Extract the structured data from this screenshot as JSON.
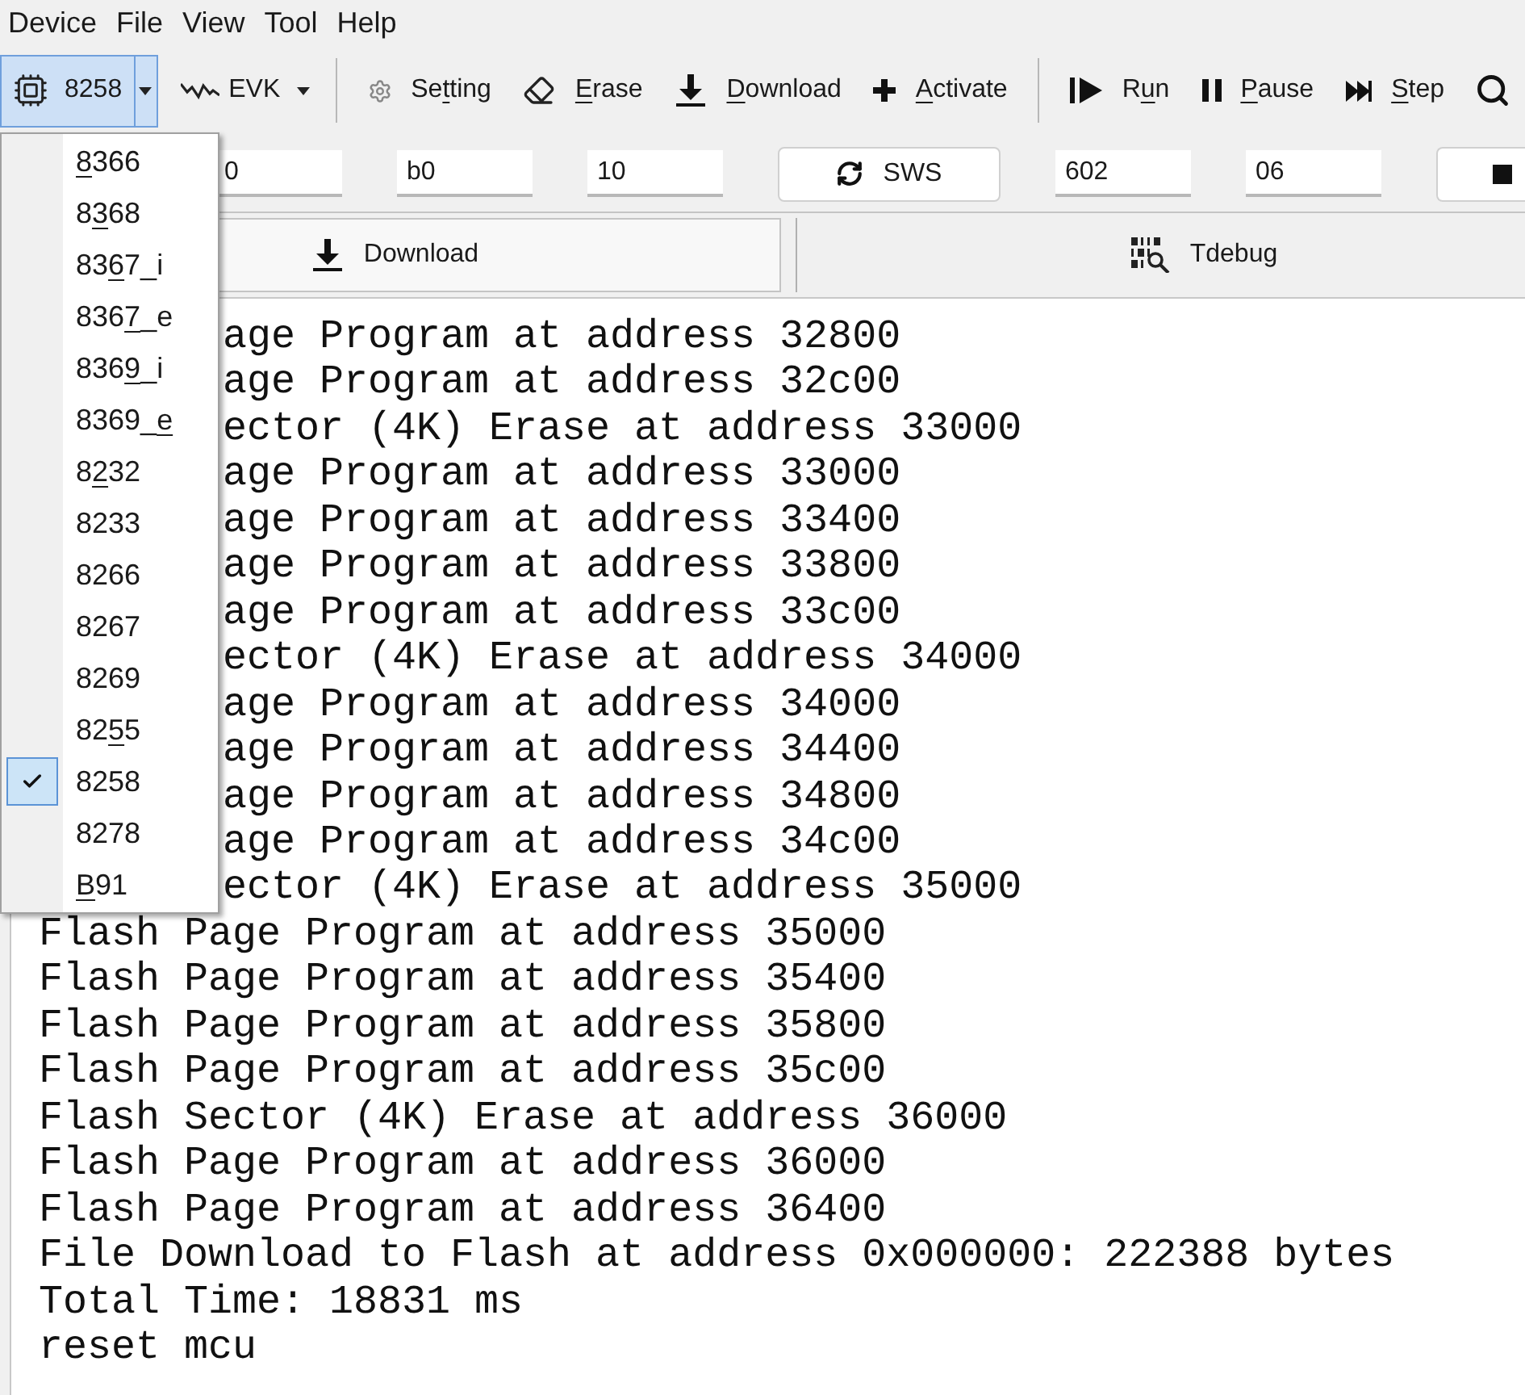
{
  "menu_bar": [
    "Device",
    "File",
    "View",
    "Tool",
    "Help"
  ],
  "toolbar": {
    "groups": [
      [
        {
          "kind": "split",
          "label": "8258",
          "expanded": true
        },
        {
          "kind": "dropdown",
          "label": "EVK"
        }
      ],
      [
        {
          "kind": "action",
          "label": [
            {
              "text": "Se",
              "underlined": false
            },
            {
              "text": "t",
              "underlined": true
            },
            {
              "text": "ting",
              "underlined": false
            }
          ]
        },
        {
          "kind": "action",
          "label": [
            {
              "text": "E",
              "underlined": true
            },
            {
              "text": "rase",
              "underlined": false
            }
          ]
        },
        {
          "kind": "action",
          "label": [
            {
              "text": "D",
              "underlined": true
            },
            {
              "text": "ownload",
              "underlined": false
            }
          ]
        },
        {
          "kind": "action",
          "label": [
            {
              "text": "A",
              "underlined": true
            },
            {
              "text": "ctivate",
              "underlined": false
            }
          ]
        }
      ],
      [
        {
          "kind": "action",
          "label": [
            {
              "text": "R",
              "underlined": false
            },
            {
              "text": "u",
              "underlined": true
            },
            {
              "text": "n",
              "underlined": false
            }
          ]
        },
        {
          "kind": "action",
          "label": [
            {
              "text": "P",
              "underlined": true
            },
            {
              "text": "ause",
              "underlined": false
            }
          ]
        },
        {
          "kind": "action",
          "label": [
            {
              "text": "S",
              "underlined": true
            },
            {
              "text": "tep",
              "underlined": false
            }
          ]
        },
        {
          "kind": "icon"
        }
      ]
    ]
  },
  "chip_menu": {
    "items": [
      {
        "label": [
          {
            "text": "8",
            "underlined": true
          },
          {
            "text": "366",
            "underlined": false
          }
        ],
        "selected": false
      },
      {
        "label": [
          {
            "text": "8",
            "underlined": false
          },
          {
            "text": "3",
            "underlined": true
          },
          {
            "text": "68",
            "underlined": false
          }
        ],
        "selected": false
      },
      {
        "label": [
          {
            "text": "83",
            "underlined": false
          },
          {
            "text": "6",
            "underlined": true
          },
          {
            "text": "7_i",
            "underlined": false
          }
        ],
        "selected": false
      },
      {
        "label": [
          {
            "text": "836",
            "underlined": false
          },
          {
            "text": "7",
            "underlined": true
          },
          {
            "text": "_e",
            "underlined": false
          }
        ],
        "selected": false
      },
      {
        "label": [
          {
            "text": "836",
            "underlined": false
          },
          {
            "text": "9",
            "underlined": true
          },
          {
            "text": "_i",
            "underlined": false
          }
        ],
        "selected": false
      },
      {
        "label": [
          {
            "text": "8369_",
            "underlined": false
          },
          {
            "text": "e",
            "underlined": true
          }
        ],
        "selected": false
      },
      {
        "label": [
          {
            "text": "8",
            "underlined": false
          },
          {
            "text": "2",
            "underlined": true
          },
          {
            "text": "32",
            "underlined": false
          }
        ],
        "selected": false
      },
      {
        "label": [
          {
            "text": "8233",
            "underlined": false
          }
        ],
        "selected": false
      },
      {
        "label": [
          {
            "text": "8266",
            "underlined": false
          }
        ],
        "selected": false
      },
      {
        "label": [
          {
            "text": "8267",
            "underlined": false
          }
        ],
        "selected": false
      },
      {
        "label": [
          {
            "text": "8269",
            "underlined": false
          }
        ],
        "selected": false
      },
      {
        "label": [
          {
            "text": "82",
            "underlined": false
          },
          {
            "text": "5",
            "underlined": true
          },
          {
            "text": "5",
            "underlined": false
          }
        ],
        "selected": false
      },
      {
        "label": [
          {
            "text": "8258",
            "underlined": false
          }
        ],
        "selected": true
      },
      {
        "label": [
          {
            "text": "8278",
            "underlined": false
          }
        ],
        "selected": false
      },
      {
        "label": [
          {
            "text": "B",
            "underlined": true
          },
          {
            "text": "91",
            "underlined": false
          }
        ],
        "selected": false
      }
    ]
  },
  "controls": [
    {
      "kind": "input",
      "value": "0"
    },
    {
      "kind": "input",
      "value": "b0"
    },
    {
      "kind": "input",
      "value": "10"
    },
    {
      "kind": "button",
      "label": "SWS"
    },
    {
      "kind": "input",
      "value": "602"
    },
    {
      "kind": "input",
      "value": "06"
    },
    {
      "kind": "button"
    }
  ],
  "tabs": [
    {
      "label": "Download",
      "selected": true
    },
    {
      "label": "Tdebug",
      "selected": false
    }
  ],
  "log": {
    "lines": [
      "age Program at address 32800",
      "age Program at address 32c00",
      "ector (4K) Erase at address 33000",
      "age Program at address 33000",
      "age Program at address 33400",
      "age Program at address 33800",
      "age Program at address 33c00",
      "ector (4K) Erase at address 34000",
      "age Program at address 34000",
      "age Program at address 34400",
      "age Program at address 34800",
      "age Program at address 34c00",
      "ector (4K) Erase at address 35000",
      "Flash Page Program at address 35000",
      "Flash Page Program at address 35400",
      "Flash Page Program at address 35800",
      "Flash Page Program at address 35c00",
      "Flash Sector (4K) Erase at address 36000",
      "Flash Page Program at address 36000",
      "Flash Page Program at address 36400",
      "File Download to Flash at address 0x000000: 222388 bytes",
      "Total Time: 18831 ms",
      "reset mcu"
    ]
  }
}
